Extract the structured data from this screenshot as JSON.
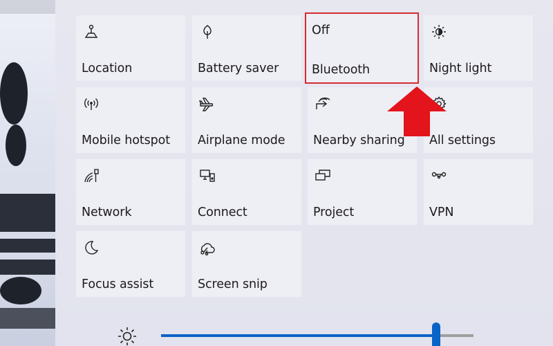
{
  "quick_actions": {
    "tiles": [
      {
        "label": "Location",
        "icon": "location-icon"
      },
      {
        "label": "Battery saver",
        "icon": "battery-saver-icon"
      },
      {
        "label": "Bluetooth",
        "state": "Off",
        "icon": "bluetooth-icon"
      },
      {
        "label": "Night light",
        "icon": "night-light-icon"
      },
      {
        "label": "Mobile hotspot",
        "icon": "mobile-hotspot-icon"
      },
      {
        "label": "Airplane mode",
        "icon": "airplane-icon"
      },
      {
        "label": "Nearby sharing",
        "icon": "nearby-sharing-icon"
      },
      {
        "label": "All settings",
        "icon": "gear-icon"
      },
      {
        "label": "Network",
        "icon": "network-icon"
      },
      {
        "label": "Connect",
        "icon": "connect-icon"
      },
      {
        "label": "Project",
        "icon": "project-icon"
      },
      {
        "label": "VPN",
        "icon": "vpn-icon"
      },
      {
        "label": "Focus assist",
        "icon": "moon-icon"
      },
      {
        "label": "Screen snip",
        "icon": "screen-snip-icon"
      }
    ]
  },
  "brightness": {
    "level": 0.88,
    "icon": "sun-icon"
  },
  "colors": {
    "highlight": "#d32c32",
    "arrow": "#e3141b",
    "accent": "#0a63c7"
  }
}
